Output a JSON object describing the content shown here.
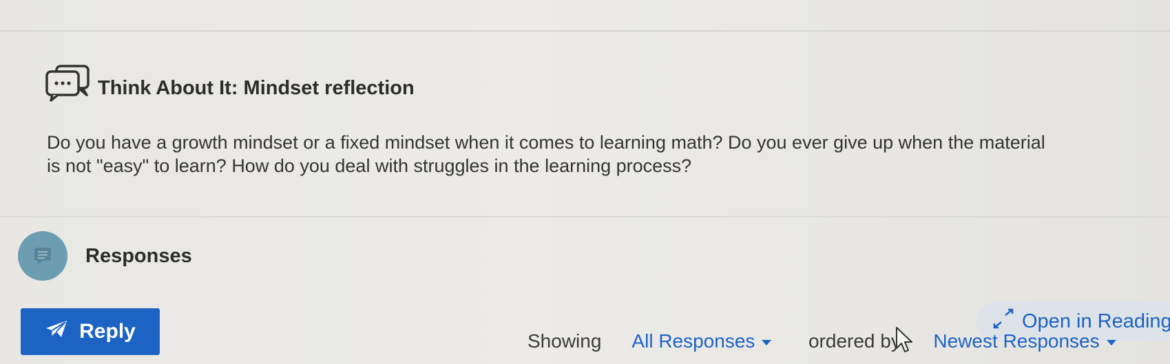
{
  "discussion": {
    "icon": "discussion-bubbles-icon",
    "title": "Think About It: Mindset reflection",
    "prompt": "Do you have a growth mindset or a fixed mindset when it comes to learning math? Do you ever give up when the material is not \"easy\" to learn? How do you deal with struggles in the learning process?"
  },
  "responses": {
    "icon": "comment-icon",
    "label": "Responses"
  },
  "actions": {
    "reply_label": "Reply",
    "reply_icon": "send-icon",
    "open_reading_label": "Open in Reading",
    "open_reading_icon": "expand-icon"
  },
  "filter": {
    "showing_label": "Showing",
    "scope_value": "All Responses",
    "ordered_label": "ordered by",
    "order_value": "Newest Responses"
  },
  "colors": {
    "accent": "#1d63c4",
    "badge": "#6c9db0",
    "text": "#2c2c2c"
  }
}
